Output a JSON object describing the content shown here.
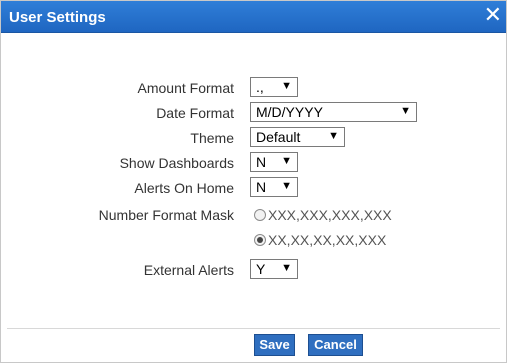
{
  "dialog": {
    "title": "User Settings",
    "close_glyph": "✕"
  },
  "fields": {
    "amount_format": {
      "label": "Amount Format",
      "value": "., "
    },
    "date_format": {
      "label": "Date Format",
      "value": "M/D/YYYY"
    },
    "theme": {
      "label": "Theme",
      "value": "Default"
    },
    "show_dashboards": {
      "label": "Show Dashboards",
      "value": "N"
    },
    "alerts_on_home": {
      "label": "Alerts On Home",
      "value": "N"
    },
    "number_format_mask": {
      "label": "Number Format Mask",
      "options": [
        {
          "label": "XXX,XXX,XXX,XXX",
          "checked": false
        },
        {
          "label": "XX,XX,XX,XX,XXX",
          "checked": true
        }
      ]
    },
    "external_alerts": {
      "label": "External Alerts",
      "value": "Y"
    }
  },
  "icons": {
    "dropdown": "chevron-down-icon",
    "close": "close-icon"
  },
  "buttons": {
    "save": "Save",
    "cancel": "Cancel"
  },
  "colors": {
    "titlebar": "#1f66c1",
    "button": "#2f6fc0"
  }
}
